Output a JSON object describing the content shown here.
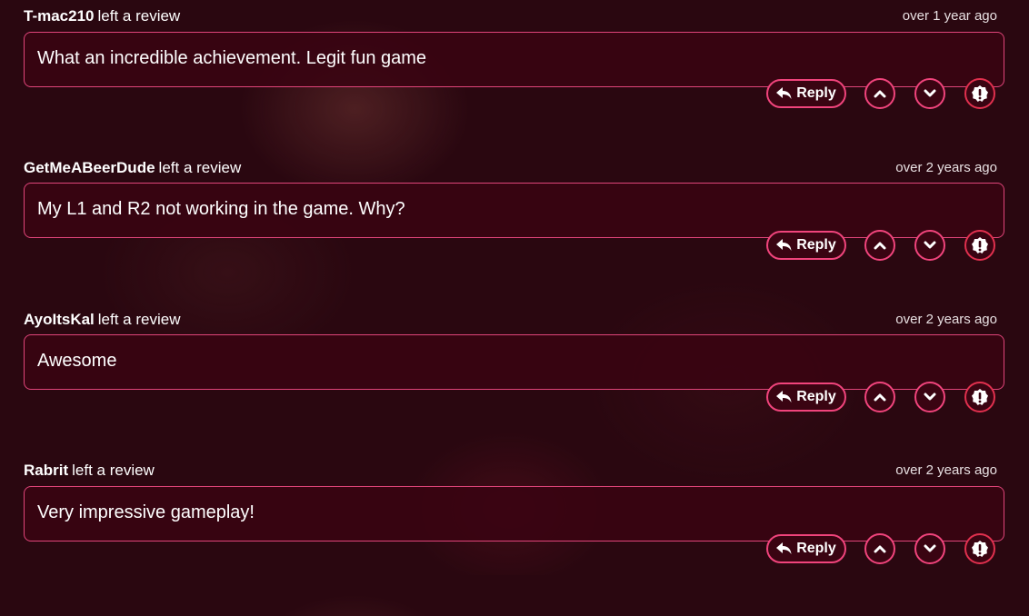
{
  "reviews": [
    {
      "user": "T-mac210",
      "action": "left a review",
      "time": "over 1 year ago",
      "text": "What an incredible achievement. Legit fun game",
      "reply_label": "Reply"
    },
    {
      "user": "GetMeABeerDude",
      "action": "left a review",
      "time": "over 2 years ago",
      "text": "My L1 and R2 not working in the game.  Why?",
      "reply_label": "Reply"
    },
    {
      "user": "AyoItsKal",
      "action": "left a review",
      "time": "over 2 years ago",
      "text": "Awesome",
      "reply_label": "Reply"
    },
    {
      "user": "Rabrit",
      "action": "left a review",
      "time": "over 2 years ago",
      "text": "Very impressive gameplay!",
      "reply_label": "Reply"
    }
  ],
  "icons": {
    "reply": "reply-arrow-icon",
    "upvote": "chevron-up-icon",
    "downvote": "chevron-down-icon",
    "report": "exclamation-badge-icon"
  },
  "colors": {
    "background": "#2a0710",
    "bubble_border": "#e0457a",
    "button_border": "#f0447c",
    "report_border": "#e0304e"
  }
}
